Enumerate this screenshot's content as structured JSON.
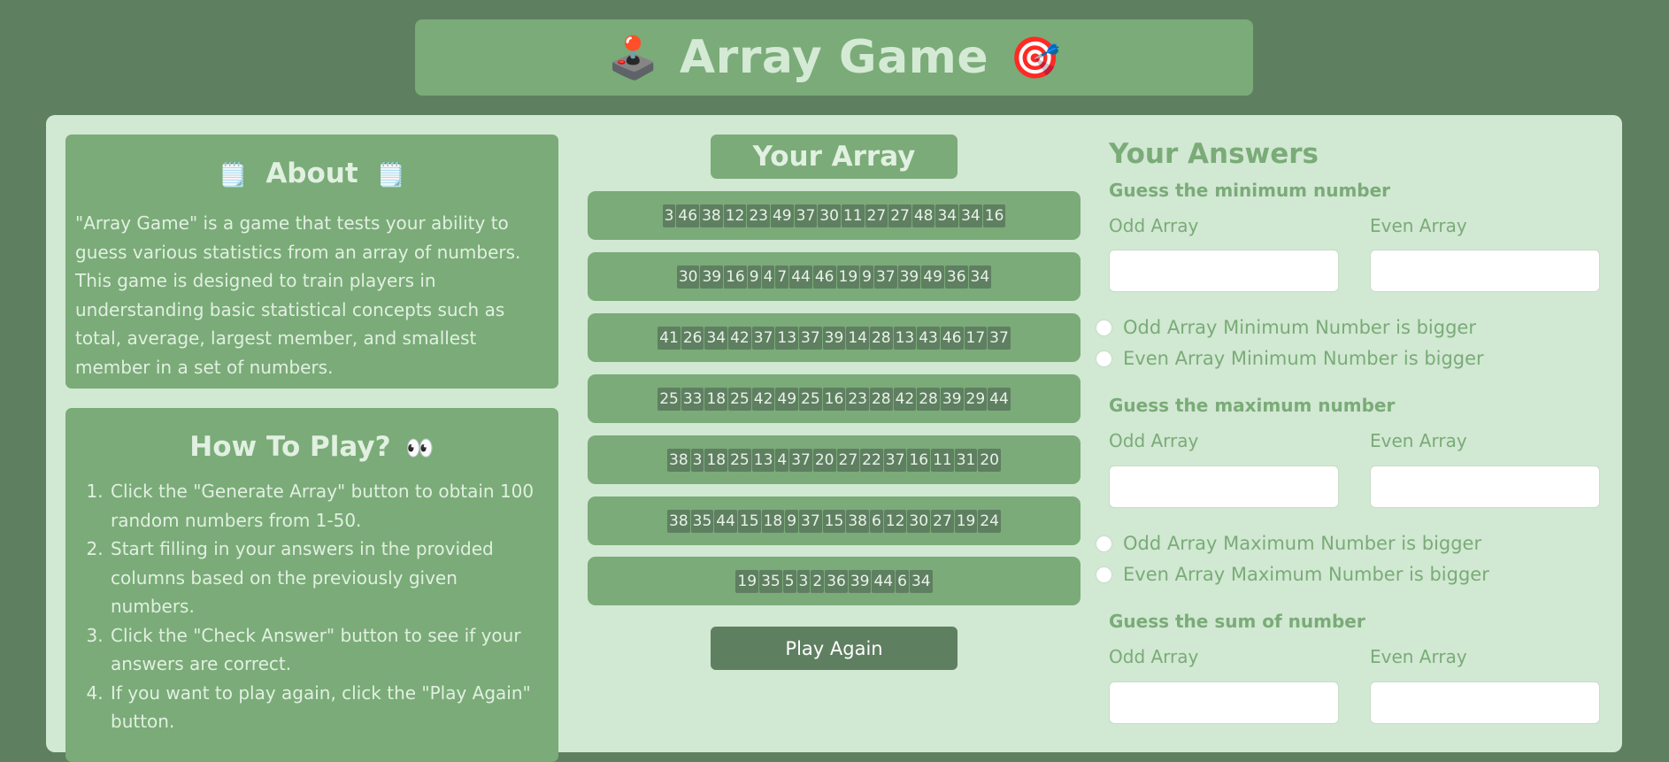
{
  "header": {
    "title": "Array Game",
    "left_emoji": "🕹️",
    "right_emoji": "🎯",
    "left_icon": "joystick-icon",
    "right_icon": "target-icon"
  },
  "about": {
    "title": "About",
    "emoji": "🗒️",
    "text": "\"Array Game\" is a game that tests your ability to guess various statistics from an array of numbers. This game is designed to train players in understanding basic statistical concepts such as total, average, largest member, and smallest member in a set of numbers."
  },
  "howto": {
    "title": "How To Play?",
    "emoji": "👀",
    "steps": [
      "Click the \"Generate Array\" button to obtain 100 random numbers from 1-50.",
      "Start filling in your answers in the provided columns based on the previously given numbers.",
      "Click the \"Check Answer\" button to see if your answers are correct.",
      "If you want to play again, click the \"Play Again\" button."
    ]
  },
  "array": {
    "title": "Your Array",
    "rows": [
      [
        3,
        46,
        38,
        12,
        23,
        49,
        37,
        30,
        11,
        27,
        27,
        48,
        34,
        34,
        16
      ],
      [
        30,
        39,
        16,
        9,
        4,
        7,
        44,
        46,
        19,
        9,
        37,
        39,
        49,
        36,
        34
      ],
      [
        41,
        26,
        34,
        42,
        37,
        13,
        37,
        39,
        14,
        28,
        13,
        43,
        46,
        17,
        37
      ],
      [
        25,
        33,
        18,
        25,
        42,
        49,
        25,
        16,
        23,
        28,
        42,
        28,
        39,
        29,
        44
      ],
      [
        38,
        3,
        18,
        25,
        13,
        4,
        37,
        20,
        27,
        22,
        37,
        16,
        11,
        31,
        20
      ],
      [
        38,
        35,
        44,
        15,
        18,
        9,
        37,
        15,
        38,
        6,
        12,
        30,
        27,
        19,
        24
      ],
      [
        19,
        35,
        5,
        3,
        2,
        36,
        39,
        44,
        6,
        34
      ]
    ],
    "play_again_label": "Play Again"
  },
  "answers": {
    "title": "Your Answers",
    "odd_label": "Odd Array",
    "even_label": "Even Array",
    "min": {
      "question": "Guess the minimum number",
      "odd_value": "",
      "even_value": "",
      "radio_odd": "Odd Array Minimum Number is bigger",
      "radio_even": "Even Array Minimum Number is bigger"
    },
    "max": {
      "question": "Guess the maximum number",
      "odd_value": "",
      "even_value": "",
      "radio_odd": "Odd Array Maximum Number is bigger",
      "radio_even": "Even Array Maximum Number is bigger"
    },
    "sum": {
      "question": "Guess the sum of number",
      "odd_value": "",
      "even_value": ""
    }
  },
  "colors": {
    "background": "#5f7f61",
    "panel": "#d1e8d2",
    "card": "#7aab78",
    "accent_text": "#7aab78"
  }
}
